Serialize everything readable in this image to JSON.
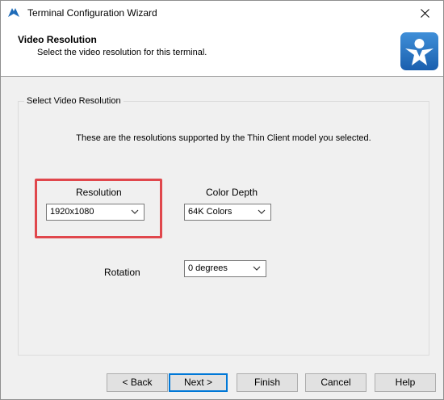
{
  "window": {
    "title": "Terminal Configuration Wizard"
  },
  "header": {
    "title": "Video Resolution",
    "subtitle": "Select the video resolution for this terminal."
  },
  "group": {
    "legend": "Select Video Resolution",
    "intro": "These are the resolutions supported by the Thin Client model you selected.",
    "resolution": {
      "label": "Resolution",
      "value": "1920x1080"
    },
    "color_depth": {
      "label": "Color Depth",
      "value": "64K Colors"
    },
    "rotation": {
      "label": "Rotation",
      "value": "0 degrees"
    }
  },
  "buttons": {
    "back": "< Back",
    "next": "Next >",
    "finish": "Finish",
    "cancel": "Cancel",
    "help": "Help"
  },
  "colors": {
    "accent": "#0078d7",
    "highlight": "#e0474c",
    "logo": "#1f6fc4"
  },
  "icons": [
    "terminal-app-icon",
    "close-icon",
    "thinclient-logo-icon",
    "chevron-down-icon"
  ]
}
